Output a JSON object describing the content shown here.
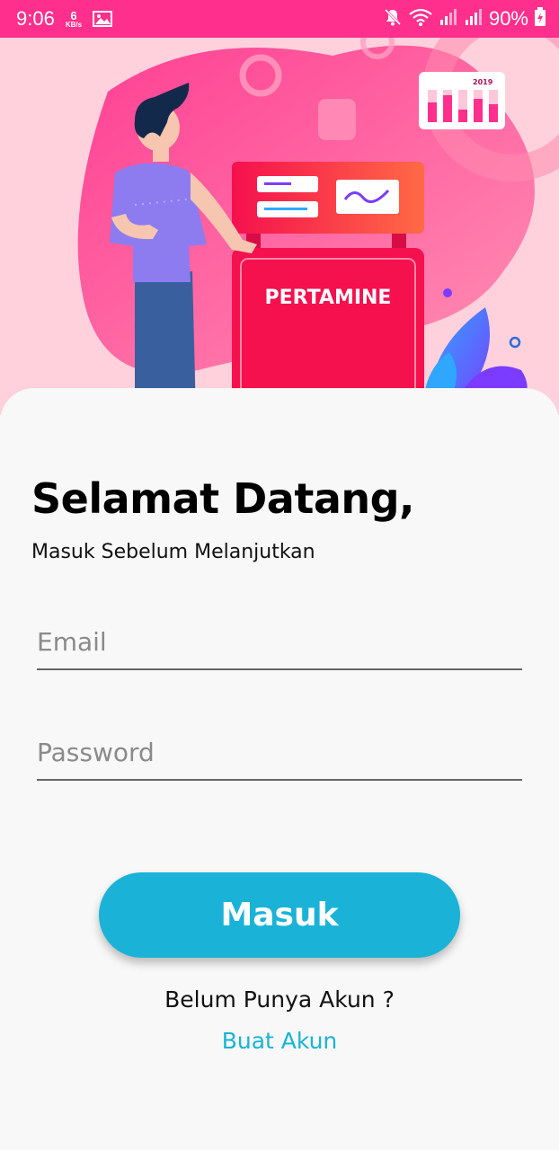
{
  "status_bar": {
    "time": "9:06",
    "net_speed_value": "6",
    "net_speed_unit": "KB/s",
    "battery_percent": "90%",
    "icons": [
      "gallery-icon",
      "mute-icon",
      "wifi-icon",
      "signal-icon",
      "signal-icon",
      "battery-charging-icon"
    ]
  },
  "hero": {
    "pump_brand": "PERTAMINE",
    "chart_year": "2019",
    "colors": {
      "pink": "#ff4f9a",
      "pump_red": "#f5104e",
      "shirt": "#8d7cf0"
    }
  },
  "login": {
    "title": "Selamat Datang,",
    "subtitle": "Masuk Sebelum Melanjutkan",
    "email_placeholder": "Email",
    "password_placeholder": "Password",
    "submit_label": "Masuk",
    "no_account_text": "Belum Punya Akun ?",
    "create_account_label": "Buat Akun"
  },
  "colors": {
    "status_bar": "#ff2f8d",
    "accent": "#1ab3d7",
    "background": "#f8f8f8"
  }
}
